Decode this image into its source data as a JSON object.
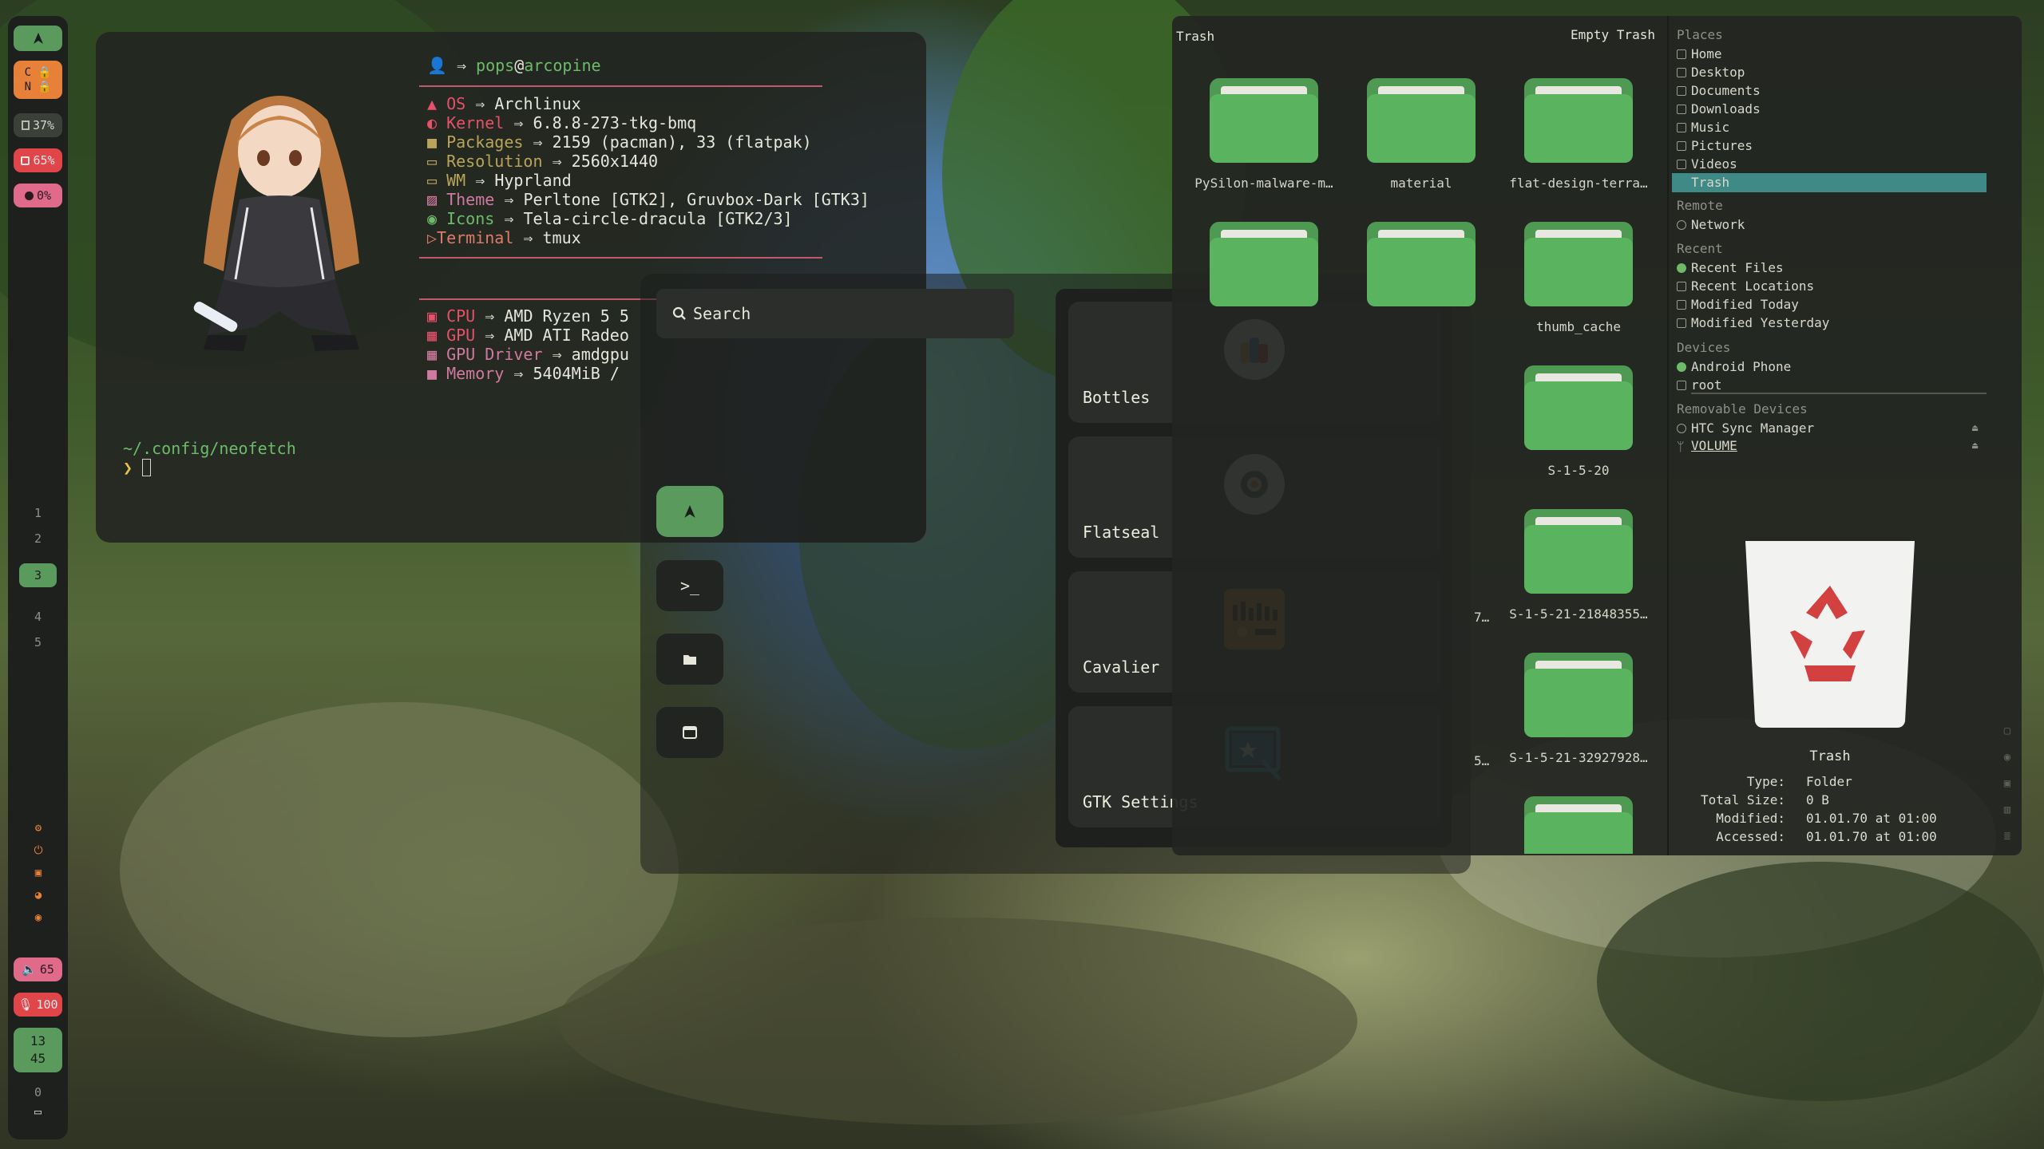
{
  "sidebar": {
    "launcher_icon": "arch-logo-icon",
    "keyboard_lock": [
      "C",
      "N"
    ],
    "gpu_percent": "37%",
    "cpu_percent": "65%",
    "mem_percent": "0%",
    "workspaces": [
      "1",
      "2",
      "3",
      "4",
      "5"
    ],
    "active_workspace": "3",
    "tray_icons": [
      "gear-icon",
      "power-icon",
      "screenshot-icon",
      "palette-icon",
      "record-icon"
    ],
    "volume": "65",
    "mic": "100",
    "clock": [
      "13",
      "45"
    ],
    "notifications": "0",
    "colors": {
      "accent": "#5a9a5c",
      "warning": "#e7813a",
      "danger": "#e0454a",
      "pink": "#e06a8a"
    }
  },
  "terminal": {
    "user_host": "pops@arcopine",
    "user_name": "pops",
    "host_name": "arcopine",
    "arrow": "⇒",
    "info": [
      {
        "key": "OS",
        "value": "Archlinux",
        "icon": "arch-icon"
      },
      {
        "key": "Kernel",
        "value": "6.8.8-273-tkg-bmq",
        "icon": "kernel-icon"
      },
      {
        "key": "Packages",
        "value": "2159 (pacman), 33 (flatpak)",
        "icon": "package-icon"
      },
      {
        "key": "Resolution",
        "value": "2560x1440",
        "icon": "monitor-icon"
      },
      {
        "key": "WM",
        "value": "Hyprland",
        "icon": "window-icon"
      },
      {
        "key": "Theme",
        "value": "Perltone [GTK2], Gruvbox-Dark [GTK3]",
        "icon": "theme-icon"
      },
      {
        "key": "Icons",
        "value": "Tela-circle-dracula [GTK2/3]",
        "icon": "icons-icon"
      },
      {
        "key": "Terminal",
        "value": "tmux",
        "icon": "terminal-icon"
      }
    ],
    "hardware": [
      {
        "key": "CPU",
        "value": "AMD Ryzen 5 5",
        "icon": "cpu-icon"
      },
      {
        "key": "GPU",
        "value": "AMD ATI Radeo",
        "icon": "gpu-icon"
      },
      {
        "key": "GPU Driver",
        "value": "amdgpu",
        "icon": "driver-icon"
      },
      {
        "key": "Memory",
        "value": "5404MiB /",
        "icon": "memory-icon"
      }
    ],
    "cwd": "~/.config/neofetch",
    "prompt": "❯"
  },
  "launcher": {
    "search_placeholder": "Search",
    "side_icons": [
      "arch-logo-icon",
      "terminal-prompt-icon",
      "folder-icon",
      "window-icon"
    ],
    "apps": [
      {
        "name": "Bottles",
        "icon": "bottles-icon"
      },
      {
        "name": "Flatseal",
        "icon": "flatseal-icon"
      },
      {
        "name": "Cavalier",
        "icon": "cavalier-icon"
      },
      {
        "name": "GTK Settings",
        "icon": "gtk-settings-icon"
      }
    ]
  },
  "file_manager": {
    "location": "Trash",
    "empty_trash": "Empty Trash",
    "items": [
      "PySilon-malware-m…",
      "material",
      "flat-design-terra…",
      "",
      "",
      "thumb_cache",
      "S-1-5-20",
      "S-1-5-21-21848355…",
      "S-1-5-21-32927928…",
      ""
    ],
    "partial_labels": [
      "7…",
      "5…"
    ],
    "places_header": "Places",
    "places": [
      "Home",
      "Desktop",
      "Documents",
      "Downloads",
      "Music",
      "Pictures",
      "Videos",
      "Trash"
    ],
    "remote_header": "Remote",
    "remote": [
      "Network"
    ],
    "recent_header": "Recent",
    "recent": [
      "Recent Files",
      "Recent Locations",
      "Modified Today",
      "Modified Yesterday"
    ],
    "devices_header": "Devices",
    "devices": [
      "Android Phone",
      "root"
    ],
    "removable_header": "Removable Devices",
    "removable": [
      "HTC Sync Manager",
      "VOLUME"
    ],
    "info": {
      "title": "Trash",
      "type_label": "Type:",
      "type_value": "Folder",
      "size_label": "Total Size:",
      "size_value": "0 B",
      "modified_label": "Modified:",
      "modified_value": "01.01.70 at 01:00",
      "accessed_label": "Accessed:",
      "accessed_value": "01.01.70 at 01:00"
    }
  }
}
